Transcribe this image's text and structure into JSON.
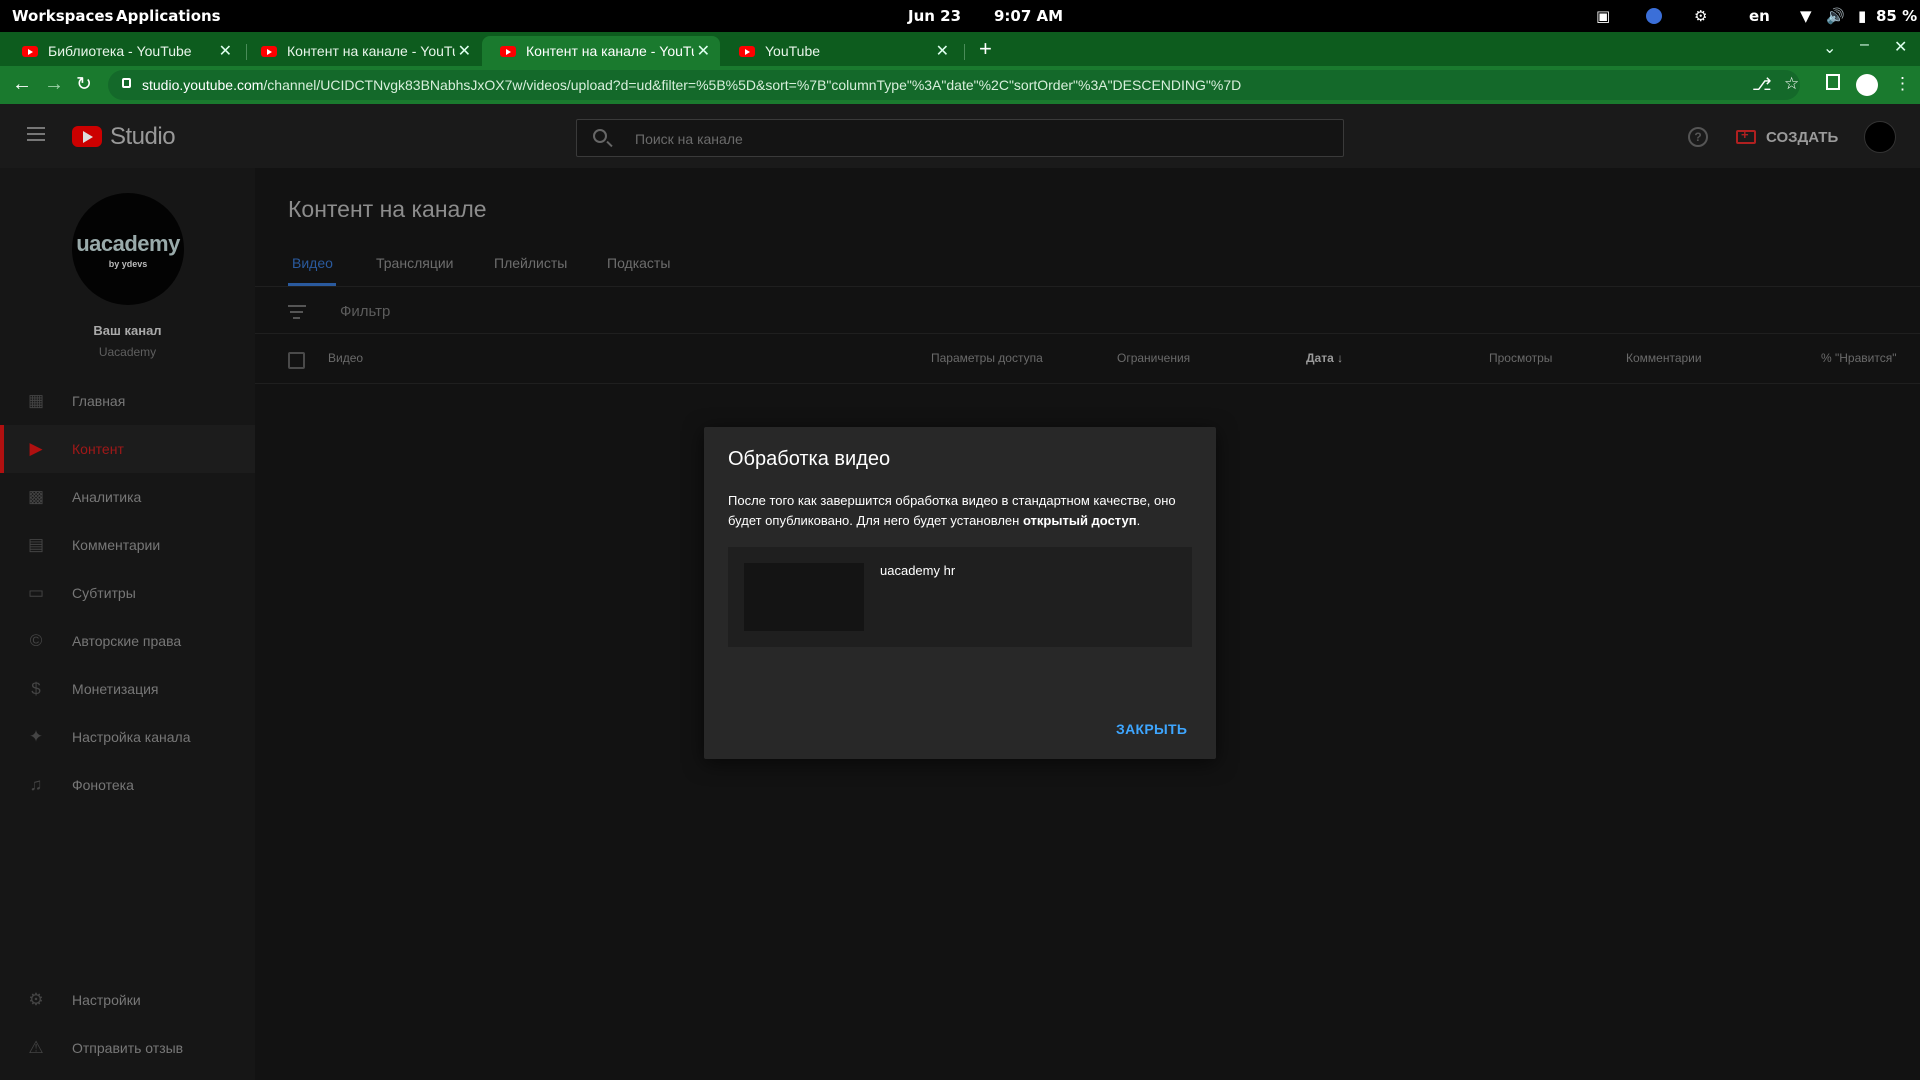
{
  "os": {
    "workspaces": "Workspaces",
    "applications": "Applications",
    "date": "Jun 23",
    "time": "9:07 AM",
    "lang": "en",
    "battery": "85 %"
  },
  "browser": {
    "tabs": [
      {
        "label": "Библиотека - YouTube",
        "active": false
      },
      {
        "label": "Контент на канале - YouTube",
        "active": false
      },
      {
        "label": "Контент на канале - YouTube",
        "active": true
      },
      {
        "label": "YouTube",
        "active": false
      }
    ],
    "new_tab": "+",
    "url_host": "studio.youtube.com",
    "url_path": "/channel/UCIDCTNvgk83BNabhsJxOX7w/videos/upload?d=ud&filter=%5B%5D&sort=%7B\"columnType\"%3A\"date\"%2C\"sortOrder\"%3A\"DESCENDING\"%7D"
  },
  "header": {
    "studio": "Studio",
    "search_placeholder": "Поиск на канале",
    "help": "?",
    "create": "СОЗДАТЬ"
  },
  "sidebar": {
    "avatar_text": "uacademy",
    "avatar_sub": "by ydevs",
    "channel_label": "Ваш канал",
    "channel_name": "Uacademy",
    "items": [
      {
        "label": "Главная",
        "icon": "dashboard-icon"
      },
      {
        "label": "Контент",
        "icon": "content-icon",
        "active": true
      },
      {
        "label": "Аналитика",
        "icon": "analytics-icon"
      },
      {
        "label": "Комментарии",
        "icon": "comments-icon"
      },
      {
        "label": "Субтитры",
        "icon": "subtitles-icon"
      },
      {
        "label": "Авторские права",
        "icon": "copyright-icon"
      },
      {
        "label": "Монетизация",
        "icon": "monetization-icon"
      },
      {
        "label": "Настройка канала",
        "icon": "customization-icon"
      },
      {
        "label": "Фонотека",
        "icon": "audio-library-icon"
      }
    ],
    "bottom_items": [
      {
        "label": "Настройки",
        "icon": "settings-icon"
      },
      {
        "label": "Отправить отзыв",
        "icon": "feedback-icon"
      }
    ]
  },
  "main": {
    "title": "Контент на канале",
    "tabs": [
      "Видео",
      "Трансляции",
      "Плейлисты",
      "Подкасты"
    ],
    "filter": "Фильтр",
    "columns": {
      "video": "Видео",
      "visibility": "Параметры доступа",
      "restrictions": "Ограничения",
      "date": "Дата",
      "views": "Просмотры",
      "comments": "Комментарии",
      "likes": "% \"Нравится\""
    }
  },
  "dialog": {
    "title": "Обработка видео",
    "body_text": "После того как завершится обработка видео в стандартном качестве, оно будет опубликовано. Для него будет установлен ",
    "body_bold": "открытый доступ",
    "body_end": ".",
    "video_title": "uacademy hr",
    "close": "ЗАКРЫТЬ"
  }
}
